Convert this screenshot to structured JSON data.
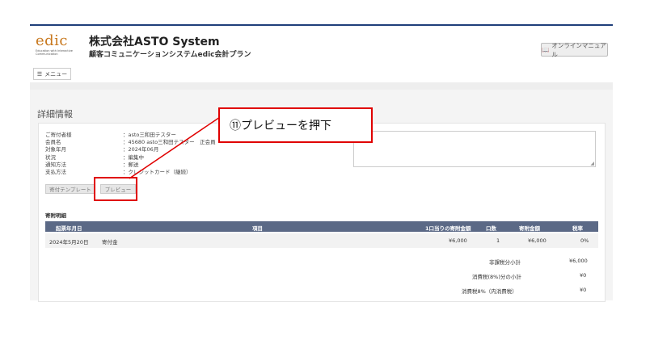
{
  "header": {
    "logo_text": "edic",
    "logo_sub": "Education with Interactive Communication",
    "company": "株式会社ASTO System",
    "plan": "顧客コミュニケーションシステムedic会計プラン",
    "manual_button": "オンラインマニュアル",
    "menu_button": "メニュー"
  },
  "section_title": "詳細情報",
  "info": [
    {
      "key": "ご寄付者様",
      "value": "：asto三和田テスター"
    },
    {
      "key": "会員名",
      "value": "：45680 asto三和田テスター　正会員"
    },
    {
      "key": "対象年月",
      "value": "：2024年06月"
    },
    {
      "key": "状況",
      "value": "：編集中"
    },
    {
      "key": "通知方法",
      "value": "：郵送"
    },
    {
      "key": "支払方法",
      "value": "：クレジットカード（継続）"
    }
  ],
  "buttons": {
    "template": "寄付テンプレート",
    "preview": "プレビュー"
  },
  "details_title": "寄附明細",
  "table": {
    "headers": [
      "起票年月日",
      "項目",
      "1口当りの寄附金額",
      "口数",
      "寄附金額",
      "税率"
    ],
    "rows": [
      [
        "2024年5月20日",
        "寄付金",
        "¥6,000",
        "1",
        "¥6,000",
        "0%"
      ]
    ]
  },
  "summary": [
    {
      "label": "非課税分小計",
      "value": "¥6,000"
    },
    {
      "label": "消費税(8%)分の小計",
      "value": "¥0"
    },
    {
      "label": "消費税8%（内消費税）",
      "value": "¥0"
    }
  ],
  "callout": "⑪プレビューを押下",
  "colors": {
    "accent_line": "#1f3f7a",
    "table_header": "#5b6986",
    "annotation": "#e00000",
    "logo": "#c8781e"
  }
}
